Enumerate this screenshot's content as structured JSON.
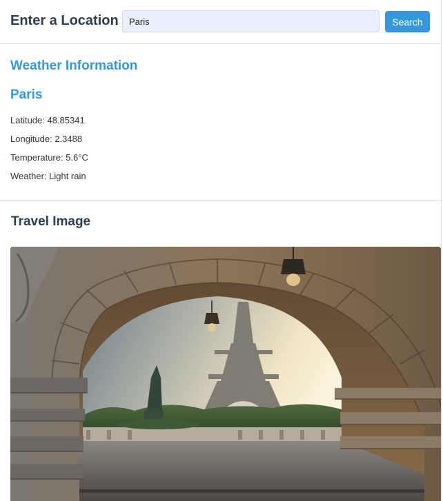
{
  "search": {
    "title": "Enter a Location",
    "input_value": "Paris",
    "button_label": "Search"
  },
  "weather": {
    "heading": "Weather Information",
    "city": "Paris",
    "latitude": "Latitude: 48.85341",
    "longitude": "Longitude: 2.3488",
    "temperature": "Temperature: 5.6°C",
    "condition": "Weather: Light rain"
  },
  "travel": {
    "heading": "Travel Image"
  },
  "colors": {
    "accent": "#3498db",
    "heading_dark": "#2c3e50",
    "input_bg": "#e8f0fe"
  }
}
